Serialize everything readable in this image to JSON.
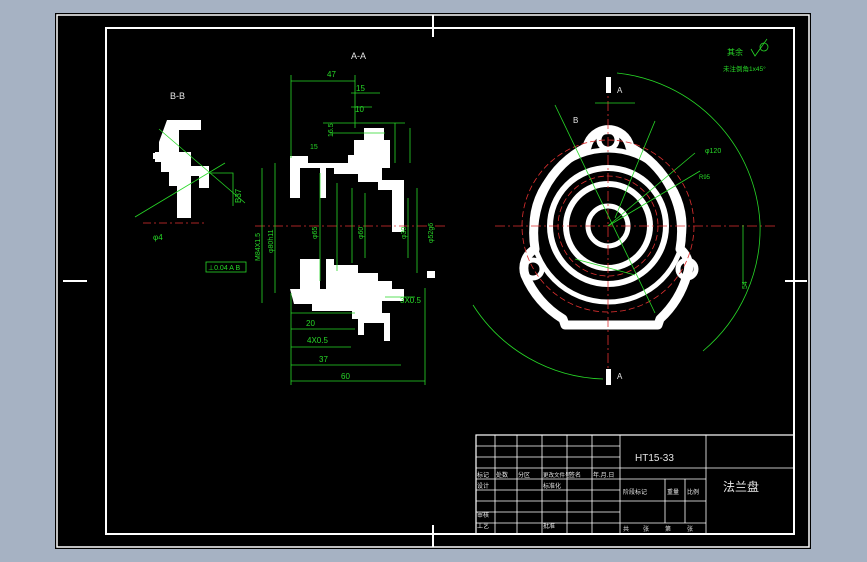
{
  "colors": {
    "viewport_bg": "#a6b2c3",
    "paper": "#000000",
    "outline": "#ffffff",
    "dimension": "#27d827",
    "hidden_line": "#e03030",
    "text_white": "#e6e6e6"
  },
  "drawing": {
    "section_aa": "A-A",
    "section_bb": "B-B",
    "cut_a_top": "A",
    "cut_a_bottom": "A",
    "cut_b": "B",
    "roughness_top_label": "其余",
    "chamfer_note": "未注倒角1x45°",
    "tolerance_frame": "⊥0.04 A B"
  },
  "dimensions": {
    "d47": "47",
    "d15a": "15",
    "d10": "10",
    "d16_5": "16.5",
    "d15b": "15",
    "d20": "20",
    "d4x0_5": "4X0.5",
    "d37": "37",
    "d60": "60",
    "d3x0_5": "3X0.5",
    "d_b37": "B37",
    "d_phi4": "φ4",
    "d_m84": "M84X1.5",
    "d_phi80": "φ80h11",
    "d_phi65": "φ65",
    "d_phi60": "φ60",
    "d_phi30": "φ30",
    "d_phi52": "φ52g6",
    "d_phi120": "φ120",
    "d_54": "54",
    "d_r": "R95"
  },
  "title_block": {
    "material": "HT15-33",
    "part_name": "法兰盘",
    "row_labels": [
      "标记",
      "处数",
      "分区",
      "更改文件号",
      "签名",
      "年.月.日"
    ],
    "designer": "设计",
    "standard": "标准化",
    "checker": "审核",
    "process": "工艺",
    "approve": "批准",
    "stage_label": "阶段标记",
    "weight_label": "重量",
    "scale_label": "比例",
    "sheet_label_1": "共",
    "sheet_label_2": "张",
    "sheet_label_3": "第",
    "sheet_label_4": "张"
  }
}
